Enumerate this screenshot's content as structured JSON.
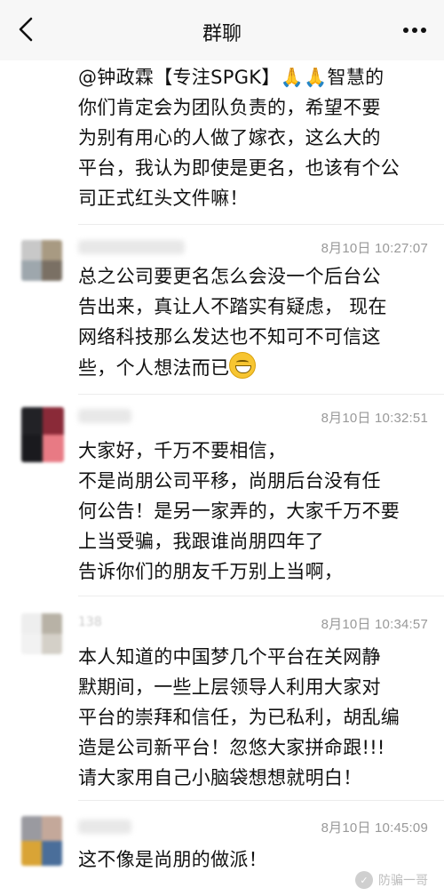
{
  "header": {
    "title": "群聊",
    "back_icon": "chevron-left-icon",
    "more_icon": "more-dots-icon"
  },
  "messages": [
    {
      "text": "@钟政霖【专注SPGK】🙏🙏智慧的\n你们肯定会为团队负责的，希望不要\n为别有用心的人做了嫁衣，这么大的\n平台，我认为即使是更名，也该有个公\n司正式红头文件嘛！"
    },
    {
      "time": "8月10日  10:27:07",
      "text": "总之公司要更名怎么会没一个后台公\n告出来，真让人不踏实有疑虑，  现在\n网络科技那么发达也不知可不可信这\n些，个人想法而已"
    },
    {
      "time": "8月10日  10:32:51",
      "text": "大家好，千万不要相信，\n不是尚朋公司平移，尚朋后台没有任\n何公告！是另一家弄的，大家千万不要\n上当受骗，我跟谁尚朋四年了\n告诉你们的朋友千万别上当啊，"
    },
    {
      "time": "8月10日  10:34:57",
      "nick": "138",
      "text": "本人知道的中国梦几个平台在关网静\n默期间，一些上层领导人利用大家对\n平台的崇拜和信任，为已私利，胡乱编\n造是公司新平台！忽悠大家拼命跟!!!\n请大家用自己小脑袋想想就明白！"
    },
    {
      "time": "8月10日  10:45:09",
      "text": "这不像是尚朋的做派！"
    }
  ],
  "watermark": {
    "text": "防骗一哥"
  },
  "colors": {
    "header_bg": "#f7f7f7",
    "time_text": "#999999",
    "divider": "#ececec"
  }
}
